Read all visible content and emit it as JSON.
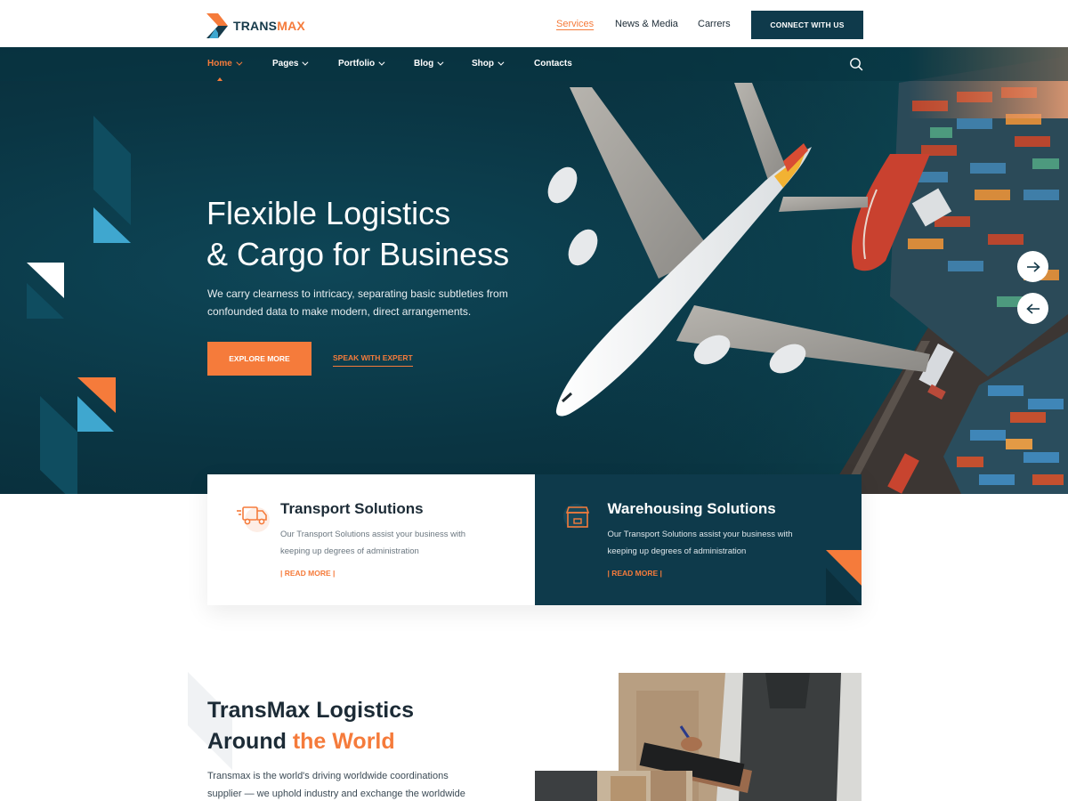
{
  "brand": {
    "name_part1": "TRANS",
    "name_part2": "MAX"
  },
  "topnav": {
    "links": [
      {
        "label": "Services",
        "active": true
      },
      {
        "label": "News & Media",
        "active": false
      },
      {
        "label": "Carrers",
        "active": false
      }
    ],
    "cta_label": "CONNECT WITH US"
  },
  "mainnav": {
    "items": [
      {
        "label": "Home",
        "has_dropdown": true,
        "active": true
      },
      {
        "label": "Pages",
        "has_dropdown": true,
        "active": false
      },
      {
        "label": "Portfolio",
        "has_dropdown": true,
        "active": false
      },
      {
        "label": "Blog",
        "has_dropdown": true,
        "active": false
      },
      {
        "label": "Shop",
        "has_dropdown": true,
        "active": false
      },
      {
        "label": "Contacts",
        "has_dropdown": false,
        "active": false
      }
    ],
    "search_icon": "search-icon"
  },
  "hero": {
    "title_line1": "Flexible Logistics",
    "title_line2": "& Cargo for Business",
    "text_line1": "We carry clearness to intricacy, separating basic subtleties from",
    "text_line2": "confounded data to make modern, direct arrangements.",
    "primary_button": "EXPLORE MORE",
    "secondary_link": "SPEAK WITH EXPERT",
    "next_icon": "arrow-right-icon",
    "prev_icon": "arrow-left-icon"
  },
  "features": [
    {
      "icon": "truck-icon",
      "title": "Transport Solutions",
      "text_line1": "Our Transport Solutions assist your business with",
      "text_line2": "keeping up degrees of administration",
      "link": "| READ MORE |",
      "theme": "light"
    },
    {
      "icon": "warehouse-box-icon",
      "title": "Warehousing Solutions",
      "text_line1": "Our Transport Solutions assist your business with",
      "text_line2": "keeping up degrees of administration",
      "link": "| READ MORE |",
      "theme": "dark"
    }
  ],
  "about": {
    "title_line1": "TransMax Logistics",
    "title_line2_plain": "Around ",
    "title_line2_accent": "the World",
    "text_line1": "Transmax is the world's driving worldwide coordinations",
    "text_line2": "supplier — we uphold industry and exchange the worldwide"
  },
  "colors": {
    "accent": "#f57b3b",
    "dark": "#0e3a4b",
    "hero_bg": "#0a3543",
    "light_blue": "#3fa7cf"
  }
}
